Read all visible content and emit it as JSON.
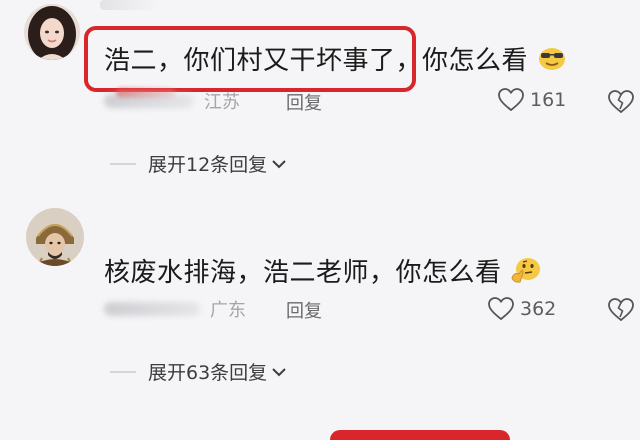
{
  "comments": [
    {
      "text": "浩二，你们村又干坏事了，你怎么看",
      "location": "江苏",
      "reply_label": "回复",
      "likes": "161",
      "expand_label": "展开12条回复",
      "emoji": "sunglasses-smile-emoji"
    },
    {
      "text": "核废水排海，浩二老师，你怎么看",
      "location": "广东",
      "reply_label": "回复",
      "likes": "362",
      "expand_label": "展开63条回复",
      "emoji": "thinking-face-emoji"
    }
  ],
  "colors": {
    "highlight": "#d8262b",
    "background": "#f5f5f7"
  }
}
